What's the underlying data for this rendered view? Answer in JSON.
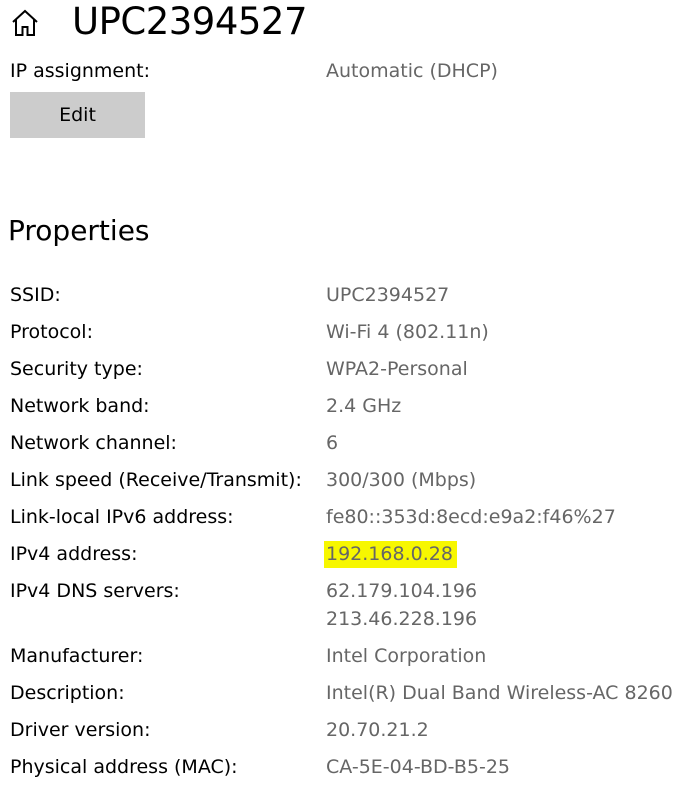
{
  "header": {
    "title": "UPC2394527",
    "home_icon": "home-icon"
  },
  "ip_assignment": {
    "label": "IP assignment:",
    "value": "Automatic (DHCP)",
    "edit_label": "Edit"
  },
  "properties": {
    "title": "Properties",
    "ssid_label": "SSID:",
    "ssid_value": "UPC2394527",
    "protocol_label": "Protocol:",
    "protocol_value": "Wi-Fi 4 (802.11n)",
    "security_label": "Security type:",
    "security_value": "WPA2-Personal",
    "band_label": "Network band:",
    "band_value": "2.4 GHz",
    "channel_label": "Network channel:",
    "channel_value": "6",
    "speed_label": "Link speed (Receive/Transmit):",
    "speed_value": "300/300 (Mbps)",
    "ipv6_label": "Link-local IPv6 address:",
    "ipv6_value": "fe80::353d:8ecd:e9a2:f46%27",
    "ipv4_label": "IPv4 address:",
    "ipv4_value": "192.168.0.28",
    "dns_label": "IPv4 DNS servers:",
    "dns_values": [
      "62.179.104.196",
      "213.46.228.196"
    ],
    "manufacturer_label": "Manufacturer:",
    "manufacturer_value": "Intel Corporation",
    "description_label": "Description:",
    "description_value": "Intel(R) Dual Band Wireless-AC 8260",
    "driver_label": "Driver version:",
    "driver_value": "20.70.21.2",
    "mac_label": "Physical address (MAC):",
    "mac_value": "CA-5E-04-BD-B5-25"
  },
  "colors": {
    "value_text": "#666666",
    "highlight": "#f7f700",
    "button_bg": "#cccccc"
  }
}
